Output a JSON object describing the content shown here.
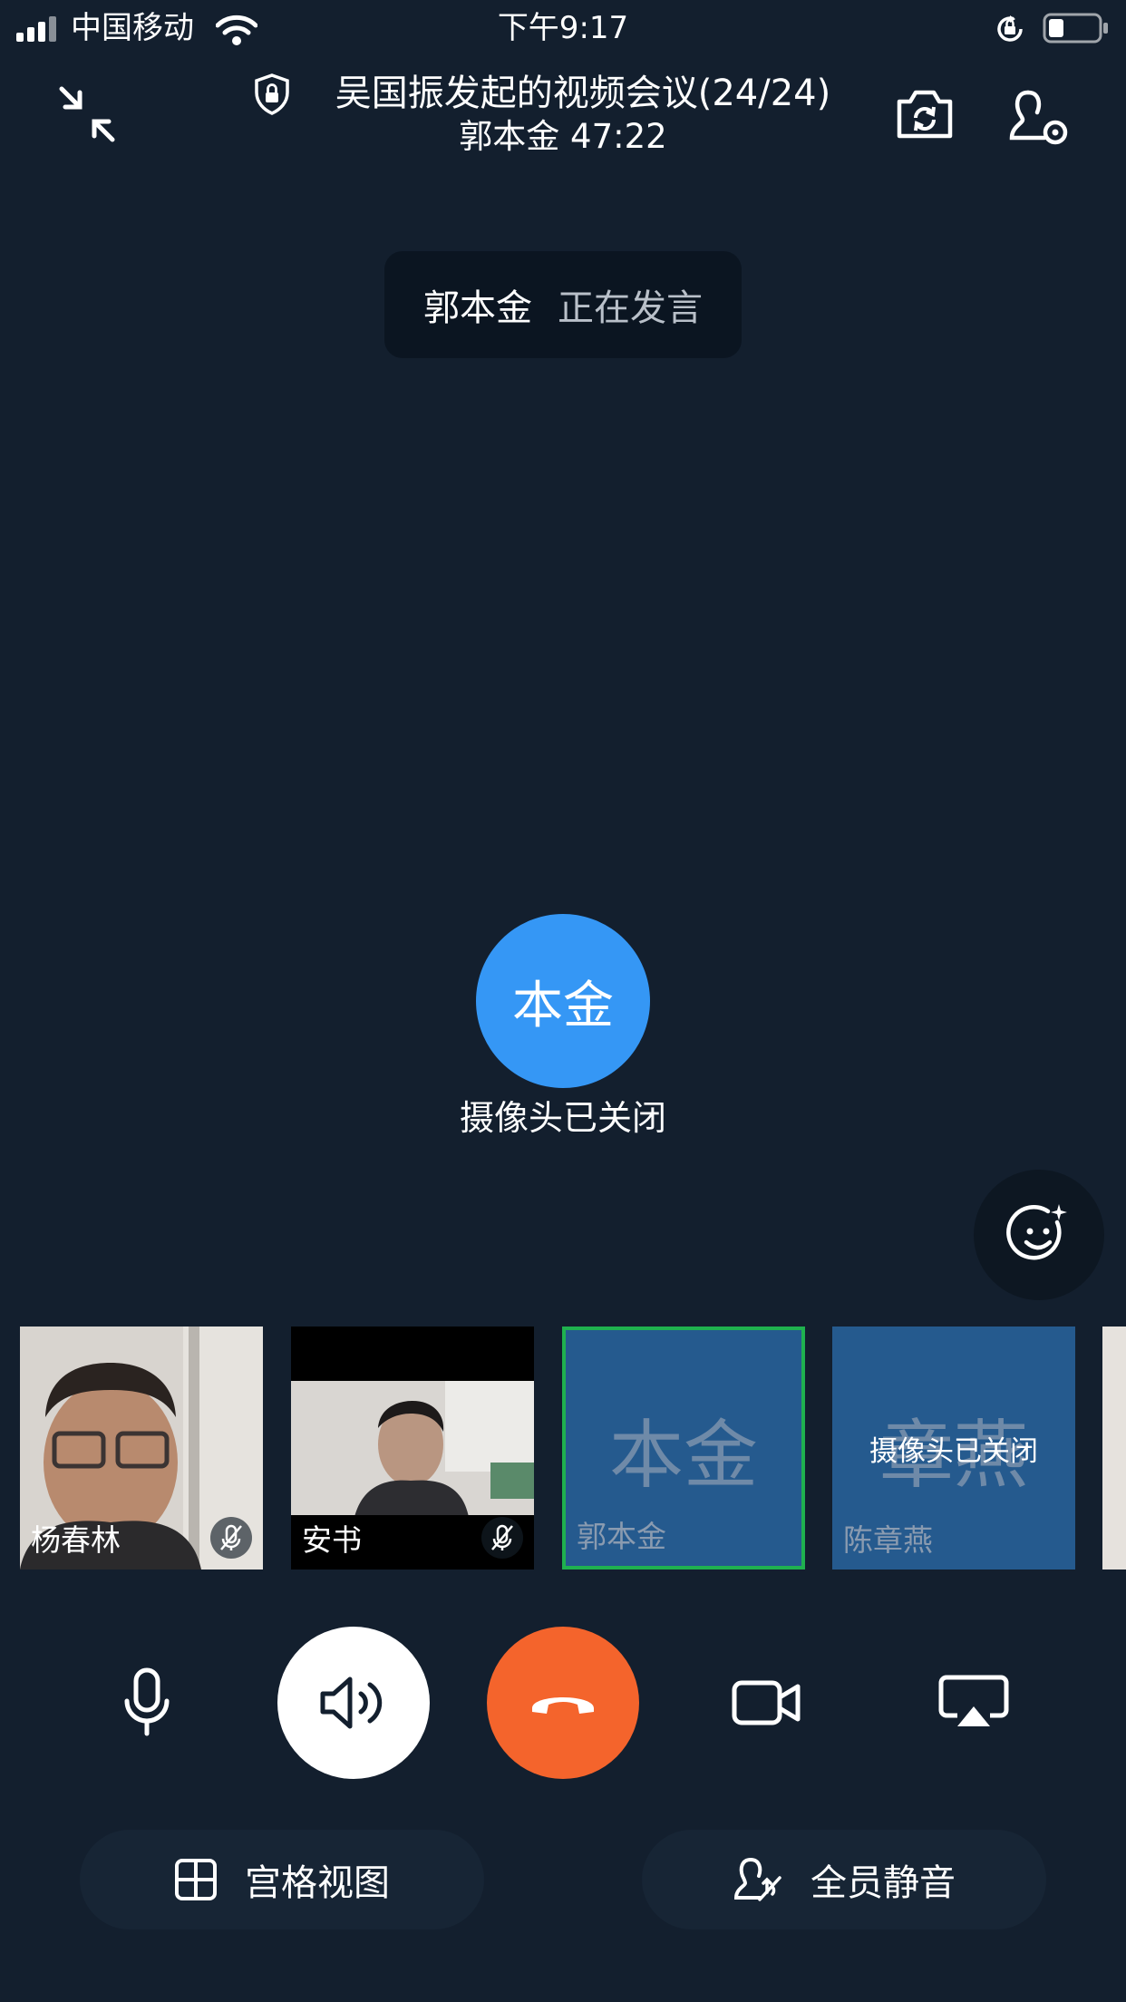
{
  "status_bar": {
    "carrier": "中国移动",
    "time": "下午9:17"
  },
  "header": {
    "title": "吴国振发起的视频会议(24/24)",
    "subtitle": "郭本金 47:22"
  },
  "speaking_toast": {
    "name": "郭本金",
    "status": "正在发言"
  },
  "main_view": {
    "avatar_text": "本金",
    "camera_status": "摄像头已关闭"
  },
  "participants": [
    {
      "name": "杨春林",
      "muted": true
    },
    {
      "name": "安书",
      "muted": true
    },
    {
      "name": "郭本金",
      "avatar_text": "本金",
      "active": true
    },
    {
      "name": "陈章燕",
      "avatar_text": "章燕",
      "overlay": "摄像头已关闭"
    }
  ],
  "controls": {
    "mic": "microphone-icon",
    "speaker": "speaker-icon",
    "hangup": "hang-up-icon",
    "camera": "video-camera-icon",
    "share": "screen-share-icon"
  },
  "bottom_actions": {
    "grid_view": "宫格视图",
    "mute_all": "全员静音"
  },
  "colors": {
    "background": "#131f2e",
    "avatar_blue": "#3597f5",
    "hangup_orange": "#f4642c",
    "active_border": "#1fb14f",
    "tile_blue": "#255a8e"
  }
}
